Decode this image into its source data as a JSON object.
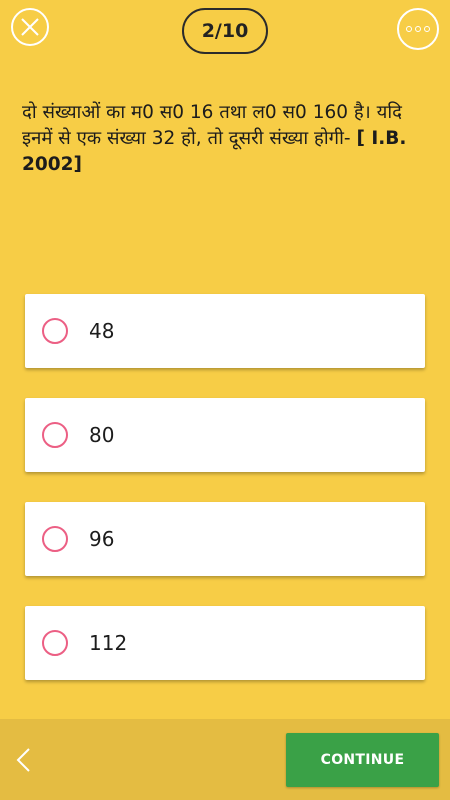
{
  "header": {
    "close_icon": "close-icon",
    "progress": "2/10",
    "more_icon": "more-options-icon"
  },
  "question": {
    "text": " दो संख्याओं का म0 स0 16 तथा ल0 स0 160 है। यदि\nइनमें से एक संख्या 32 हो, तो दूसरी संख्या होगी- ",
    "reference": "[ I.B.\n2002]"
  },
  "options": [
    {
      "label": "48",
      "selected": false
    },
    {
      "label": "80",
      "selected": false
    },
    {
      "label": "96",
      "selected": false
    },
    {
      "label": "112",
      "selected": false
    }
  ],
  "footer": {
    "back_icon": "chevron-left-icon",
    "continue_label": "CONTINUE"
  },
  "colors": {
    "background": "#f7cd46",
    "footer": "#e4bc42",
    "radio": "#ec5f84",
    "continue": "#3aa147"
  }
}
